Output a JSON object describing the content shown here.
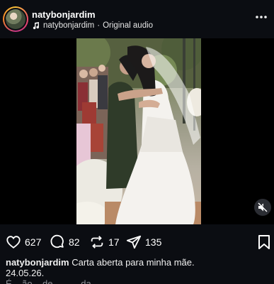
{
  "post": {
    "username": "natybonjardim",
    "audio_user": "natybonjardim",
    "audio_separator": "·",
    "audio_label": "Original audio"
  },
  "actions": {
    "likes": "627",
    "comments": "82",
    "reposts": "17",
    "shares": "135"
  },
  "caption": {
    "username": "natybonjardim",
    "text": "Carta aberta para minha mãe.",
    "date": "24.05.26.",
    "more_text": "É... ão... de... ... ...da..."
  },
  "icons": {
    "music": "music-note-icon",
    "more": "more-dots-icon",
    "mute": "speaker-muted-icon",
    "like": "heart-icon",
    "comment": "comment-bubble-icon",
    "repost": "repost-arrows-icon",
    "share": "send-paper-plane-icon",
    "save": "bookmark-icon"
  }
}
